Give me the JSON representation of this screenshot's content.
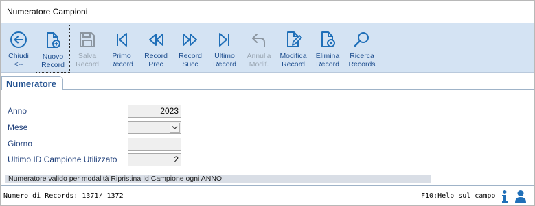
{
  "window": {
    "title": "Numeratore Campioni"
  },
  "toolbar": {
    "buttons": [
      {
        "label": "Chiudi\n<--",
        "icon": "arrow-left-circle-icon",
        "enabled": true
      },
      {
        "label": "Nuovo\nRecord",
        "icon": "new-document-icon",
        "enabled": true
      },
      {
        "label": "Salva\nRecord",
        "icon": "save-icon",
        "enabled": false
      },
      {
        "label": "Primo\nRecord",
        "icon": "first-record-icon",
        "enabled": true
      },
      {
        "label": "Record\nPrec",
        "icon": "previous-record-icon",
        "enabled": true
      },
      {
        "label": "Record\nSucc",
        "icon": "next-record-icon",
        "enabled": true
      },
      {
        "label": "Ultimo\nRecord",
        "icon": "last-record-icon",
        "enabled": true
      },
      {
        "label": "Annulla\nModif.",
        "icon": "undo-icon",
        "enabled": false
      },
      {
        "label": "Modifica\nRecord",
        "icon": "edit-document-icon",
        "enabled": true
      },
      {
        "label": "Elimina\nRecord",
        "icon": "delete-document-icon",
        "enabled": true
      },
      {
        "label": "Ricerca\nRecords",
        "icon": "search-icon",
        "enabled": true
      }
    ]
  },
  "tabs": [
    {
      "label": "Numeratore"
    }
  ],
  "form": {
    "anno": {
      "label": "Anno",
      "value": "2023"
    },
    "mese": {
      "label": "Mese",
      "value": ""
    },
    "giorno": {
      "label": "Giorno",
      "value": ""
    },
    "ultimo_id": {
      "label": "Ultimo ID Campione Utilizzato",
      "value": "2"
    },
    "info": "Numeratore valido per modalità Ripristina Id Campione ogni ANNO"
  },
  "status": {
    "records": "Numero di Records: 1371/ 1372",
    "help": "F10:Help sul campo",
    "icons": [
      "info-icon",
      "user-icon"
    ]
  },
  "colors": {
    "toolbar_bg": "#d4e3f3",
    "accent": "#1f6fb8",
    "label": "#1f3f7a"
  }
}
